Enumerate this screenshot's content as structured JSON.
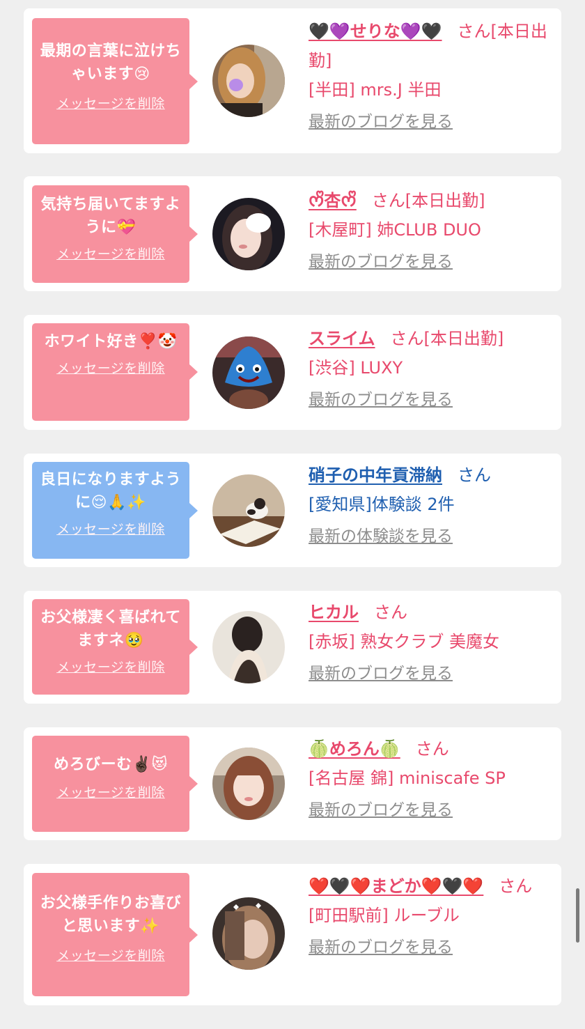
{
  "delete_label": "メッセージを削除",
  "san_label": "さん",
  "colors": {
    "page_bg": "#efefef",
    "pink_bubble": "#f7919e",
    "blue_bubble": "#87b7f2",
    "pink_text": "#e8496c",
    "blue_text": "#1f5fb0",
    "link_gray": "#8d8d8d"
  },
  "messages": [
    {
      "message": "最期の言葉に泣けちゃいます😢",
      "name": "🖤💜せりな💜🖤",
      "status": "[本日出勤]",
      "shop": "[半田] mrs.J 半田",
      "link": "最新のブログを見る",
      "theme": "pink",
      "avatar_icon": "woman-photo-icon"
    },
    {
      "message": "気持ち届いてますように💝",
      "name": "ᰔᩚ杏ᰔᩚ",
      "status": "[本日出勤]",
      "shop": "[木屋町] 姉CLUB DUO",
      "link": "最新のブログを見る",
      "theme": "pink",
      "avatar_icon": "woman-photo-icon"
    },
    {
      "message": "ホワイト好き❣️🤡",
      "name": "スライム",
      "status": "[本日出勤]",
      "shop": "[渋谷] LUXY",
      "link": "最新のブログを見る",
      "theme": "pink",
      "avatar_icon": "slime-photo-icon"
    },
    {
      "message": "良日になりますように😌🙏✨",
      "name": "硝子の中年貢滞納",
      "status": "",
      "shop": "[愛知県]体験談 2件",
      "link": "最新の体験談を見る",
      "theme": "blue",
      "avatar_icon": "cat-photo-icon"
    },
    {
      "message": "お父様凄く喜ばれてますネ🥹",
      "name": "ヒカル",
      "status": "",
      "shop": "[赤坂] 熟女クラブ 美魔女",
      "link": "最新のブログを見る",
      "theme": "pink",
      "avatar_icon": "woman-photo-icon"
    },
    {
      "message": "めろびーむ✌🏿😻",
      "name": "🍈めろん🍈",
      "status": "",
      "shop": "[名古屋 錦] miniscafe SP",
      "link": "最新のブログを見る",
      "theme": "pink",
      "avatar_icon": "woman-photo-icon"
    },
    {
      "message": "お父様手作りお喜びと思います✨",
      "name": "❤️🖤❤️まどか❤️🖤❤️",
      "status": "",
      "shop": "[町田駅前] ルーブル",
      "link": "最新のブログを見る",
      "theme": "pink",
      "avatar_icon": "woman-photo-icon"
    }
  ]
}
